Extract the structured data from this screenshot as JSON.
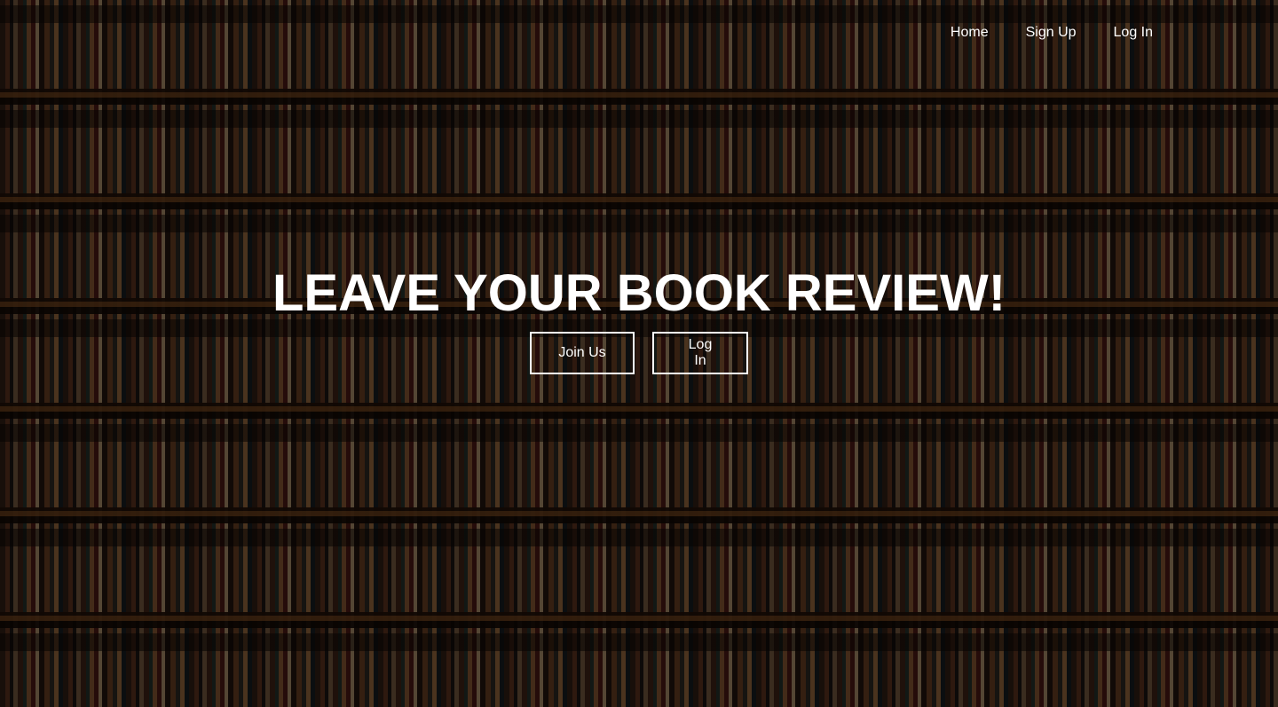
{
  "nav": {
    "items": [
      {
        "label": "Home"
      },
      {
        "label": "Sign Up"
      },
      {
        "label": "Log In"
      }
    ]
  },
  "hero": {
    "title": "LEAVE YOUR BOOK REVIEW!",
    "buttons": {
      "join_label": "Join Us",
      "login_label": "Log In"
    },
    "background": "bookshelf-image"
  },
  "colors": {
    "text": "#ffffff",
    "overlay": "rgba(0,0,0,0.58)"
  }
}
